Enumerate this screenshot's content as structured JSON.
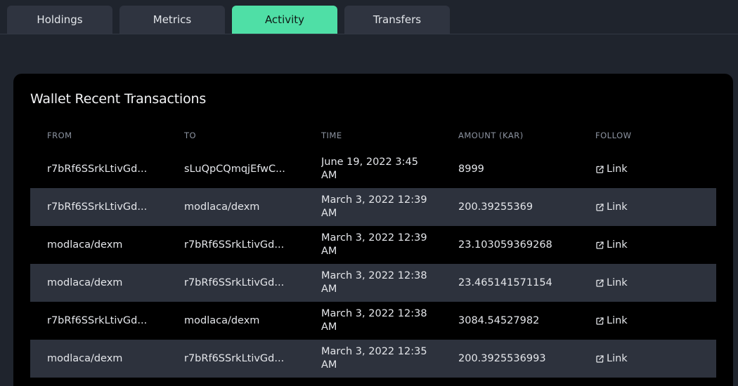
{
  "tabs": [
    {
      "label": "Holdings"
    },
    {
      "label": "Metrics"
    },
    {
      "label": "Activity"
    },
    {
      "label": "Transfers"
    }
  ],
  "card": {
    "title": "Wallet Recent Transactions",
    "columns": [
      "FROM",
      "TO",
      "TIME",
      "AMOUNT (KAR)",
      "FOLLOW"
    ]
  },
  "rows": [
    {
      "from": "r7bRf6SSrkLtivGd...",
      "to": "sLuQpCQmqjEfwC...",
      "time": "June 19, 2022 3:45 AM",
      "amount": "8999",
      "follow": "Link"
    },
    {
      "from": "r7bRf6SSrkLtivGd...",
      "to": "modlaca/dexm",
      "time": "March 3, 2022 12:39 AM",
      "amount": "200.39255369",
      "follow": "Link"
    },
    {
      "from": "modlaca/dexm",
      "to": "r7bRf6SSrkLtivGd...",
      "time": "March 3, 2022 12:39 AM",
      "amount": "23.103059369268",
      "follow": "Link"
    },
    {
      "from": "modlaca/dexm",
      "to": "r7bRf6SSrkLtivGd...",
      "time": "March 3, 2022 12:38 AM",
      "amount": "23.465141571154",
      "follow": "Link"
    },
    {
      "from": "r7bRf6SSrkLtivGd...",
      "to": "modlaca/dexm",
      "time": "March 3, 2022 12:38 AM",
      "amount": "3084.54527982",
      "follow": "Link"
    },
    {
      "from": "modlaca/dexm",
      "to": "r7bRf6SSrkLtivGd...",
      "time": "March 3, 2022 12:35 AM",
      "amount": "200.3925536993",
      "follow": "Link"
    }
  ],
  "colors": {
    "accent": "#4fdfa6",
    "background": "#1f242d",
    "card": "#000000",
    "row_alt": "#2d323d"
  },
  "icons": {
    "follow": "external-link-icon"
  }
}
